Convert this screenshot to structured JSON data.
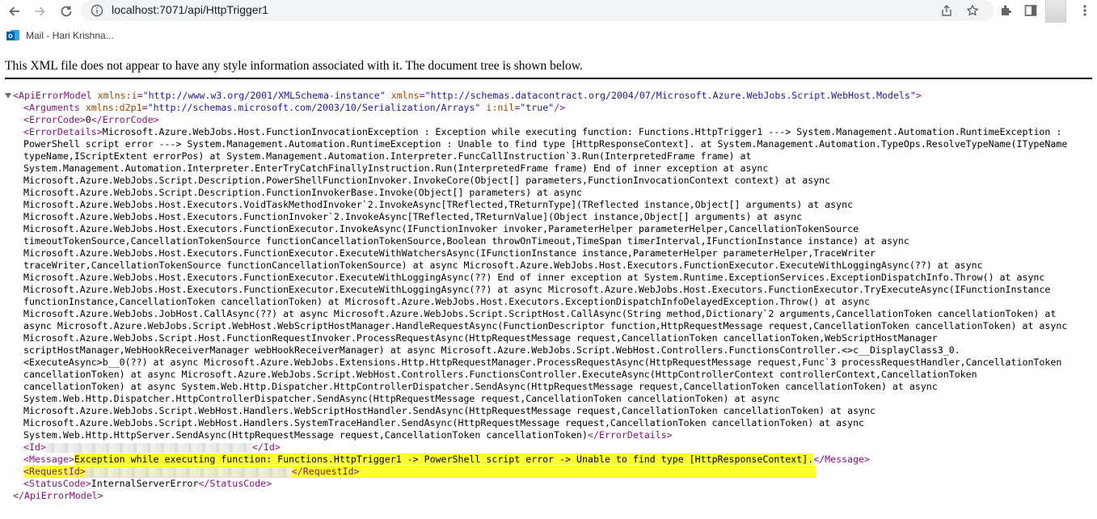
{
  "browser": {
    "url": "localhost:7071/api/HttpTrigger1",
    "bookmark": {
      "label": "Mail - Hari Krishna..."
    },
    "icons": [
      "back-icon",
      "forward-icon",
      "reload-icon",
      "info-icon",
      "share-icon",
      "star-icon",
      "extensions-icon",
      "sidebar-icon",
      "menu-icon"
    ]
  },
  "xml_notice": "This XML file does not appear to have any style information associated with it. The document tree is shown below.",
  "tree": {
    "root_open": "<ApiErrorModel",
    "root_attr1_name": "xmlns:i",
    "root_attr1_value": "\"http://www.w3.org/2001/XMLSchema-instance\"",
    "root_attr2_name": "xmlns",
    "root_attr2_value": "\"http://schemas.datacontract.org/2004/07/Microsoft.Azure.WebJobs.Script.WebHost.Models\"",
    "root_open_end": ">",
    "arguments_open": "<Arguments",
    "arguments_attr1_name": "xmlns:d2p1",
    "arguments_attr1_value": "\"http://schemas.microsoft.com/2003/10/Serialization/Arrays\"",
    "arguments_attr2_name": "i:nil",
    "arguments_attr2_value": "\"true\"",
    "arguments_close": "/>",
    "errorcode_open": "<ErrorCode>",
    "errorcode_value": "0",
    "errorcode_close": "</ErrorCode>",
    "errordetails_open": "<ErrorDetails>",
    "errordetails_first": "Microsoft.Azure.WebJobs.Host.FunctionInvocationException : Exception while executing function: Functions.HttpTrigger1 ---> System.Management.Automation.RuntimeException :",
    "errordetails_lines": [
      "PowerShell script error ---> System.Management.Automation.RuntimeException : Unable to find type [HttpResponseContext]. at System.Management.Automation.TypeOps.ResolveTypeName(ITypeName",
      "typeName,IScriptExtent errorPos) at System.Management.Automation.Interpreter.FuncCallInstruction`3.Run(InterpretedFrame frame) at",
      "System.Management.Automation.Interpreter.EnterTryCatchFinallyInstruction.Run(InterpretedFrame frame) End of inner exception at async",
      "Microsoft.Azure.WebJobs.Script.Description.PowerShellFunctionInvoker.InvokeCore(Object[] parameters,FunctionInvocationContext context) at async",
      "Microsoft.Azure.WebJobs.Script.Description.FunctionInvokerBase.Invoke(Object[] parameters) at async",
      "Microsoft.Azure.WebJobs.Host.Executors.VoidTaskMethodInvoker`2.InvokeAsync[TReflected,TReturnType](TReflected instance,Object[] arguments) at async",
      "Microsoft.Azure.WebJobs.Host.Executors.FunctionInvoker`2.InvokeAsync[TReflected,TReturnValue](Object instance,Object[] arguments) at async",
      "Microsoft.Azure.WebJobs.Host.Executors.FunctionExecutor.InvokeAsync(IFunctionInvoker invoker,ParameterHelper parameterHelper,CancellationTokenSource",
      "timeoutTokenSource,CancellationTokenSource functionCancellationTokenSource,Boolean throwOnTimeout,TimeSpan timerInterval,IFunctionInstance instance) at async",
      "Microsoft.Azure.WebJobs.Host.Executors.FunctionExecutor.ExecuteWithWatchersAsync(IFunctionInstance instance,ParameterHelper parameterHelper,TraceWriter",
      "traceWriter,CancellationTokenSource functionCancellationTokenSource) at async Microsoft.Azure.WebJobs.Host.Executors.FunctionExecutor.ExecuteWithLoggingAsync(??) at async",
      "Microsoft.Azure.WebJobs.Host.Executors.FunctionExecutor.ExecuteWithLoggingAsync(??) End of inner exception at System.Runtime.ExceptionServices.ExceptionDispatchInfo.Throw() at async",
      "Microsoft.Azure.WebJobs.Host.Executors.FunctionExecutor.ExecuteWithLoggingAsync(??) at async Microsoft.Azure.WebJobs.Host.Executors.FunctionExecutor.TryExecuteAsync(IFunctionInstance",
      "functionInstance,CancellationToken cancellationToken) at Microsoft.Azure.WebJobs.Host.Executors.ExceptionDispatchInfoDelayedException.Throw() at async",
      "Microsoft.Azure.WebJobs.JobHost.CallAsync(??) at async Microsoft.Azure.WebJobs.Script.ScriptHost.CallAsync(String method,Dictionary`2 arguments,CancellationToken cancellationToken) at",
      "async Microsoft.Azure.WebJobs.Script.WebHost.WebScriptHostManager.HandleRequestAsync(FunctionDescriptor function,HttpRequestMessage request,CancellationToken cancellationToken) at async",
      "Microsoft.Azure.WebJobs.Script.Host.FunctionRequestInvoker.ProcessRequestAsync(HttpRequestMessage request,CancellationToken cancellationToken,WebScriptHostManager",
      "scriptHostManager,WebHookReceiverManager webHookReceiverManager) at async Microsoft.Azure.WebJobs.Script.WebHost.Controllers.FunctionsController.<>c__DisplayClass3_0.",
      "<ExecuteAsync>b__0(??) at async Microsoft.Azure.WebJobs.Extensions.Http.HttpRequestManager.ProcessRequestAsync(HttpRequestMessage request,Func`3 processRequestHandler,CancellationToken",
      "cancellationToken) at async Microsoft.Azure.WebJobs.Script.WebHost.Controllers.FunctionsController.ExecuteAsync(HttpControllerContext controllerContext,CancellationToken",
      "cancellationToken) at async System.Web.Http.Dispatcher.HttpControllerDispatcher.SendAsync(HttpRequestMessage request,CancellationToken cancellationToken) at async",
      "System.Web.Http.Dispatcher.HttpControllerDispatcher.SendAsync(HttpRequestMessage request,CancellationToken cancellationToken) at async",
      "Microsoft.Azure.WebJobs.Script.WebHost.Handlers.WebScriptHostHandler.SendAsync(HttpRequestMessage request,CancellationToken cancellationToken) at async",
      "Microsoft.Azure.WebJobs.Script.WebHost.Handlers.SystemTraceHandler.SendAsync(HttpRequestMessage request,CancellationToken cancellationToken) at async"
    ],
    "errordetails_last": "System.Web.Http.HttpServer.SendAsync(HttpRequestMessage request,CancellationToken cancellationToken)",
    "errordetails_close": "</ErrorDetails>",
    "id_open": "<Id>",
    "id_close": "</Id>",
    "message_open": "<Message>",
    "message_value": "Exception while executing function: Functions.HttpTrigger1 -> PowerShell script error -> Unable to find type [HttpResponseContext].",
    "message_close": "</Message>",
    "requestid_open": "<RequestId>",
    "requestid_close": "</RequestId>",
    "statuscode_open": "<StatusCode>",
    "statuscode_value": "InternalServerError",
    "statuscode_close": "</StatusCode>",
    "root_close": "</ApiErrorModel>"
  }
}
